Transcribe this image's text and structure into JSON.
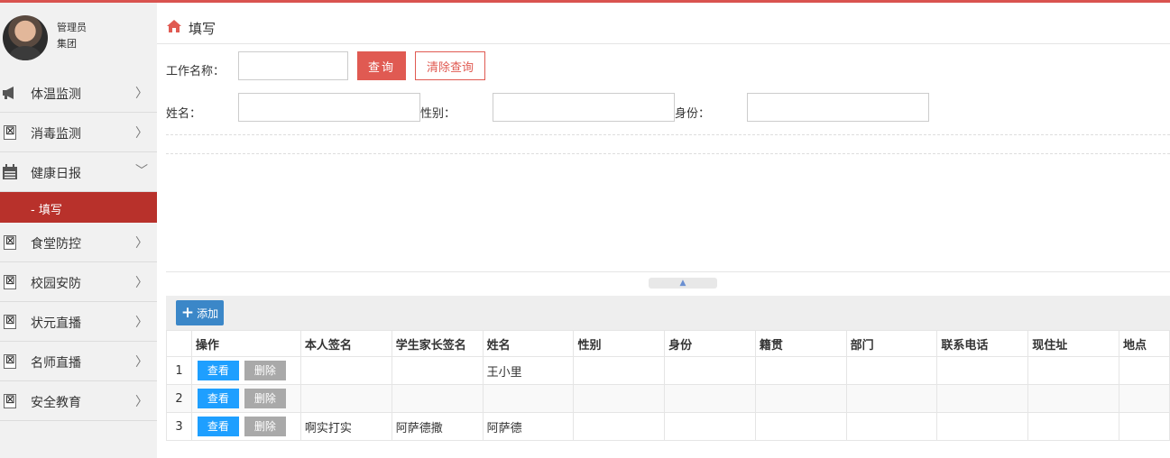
{
  "user": {
    "role": "管理员",
    "org": "集团"
  },
  "sidebar": {
    "items": [
      {
        "label": "体温监测",
        "icon": "megaphone-icon",
        "chevron": ">"
      },
      {
        "label": "消毒监测",
        "icon": "broken-image-icon",
        "chevron": ">"
      },
      {
        "label": "健康日报",
        "icon": "calendar-icon",
        "chevron": "v",
        "expanded": true
      },
      {
        "label": "食堂防控",
        "icon": "broken-image-icon",
        "chevron": ">"
      },
      {
        "label": "校园安防",
        "icon": "broken-image-icon",
        "chevron": ">"
      },
      {
        "label": "状元直播",
        "icon": "broken-image-icon",
        "chevron": ">"
      },
      {
        "label": "名师直播",
        "icon": "broken-image-icon",
        "chevron": ">"
      },
      {
        "label": "安全教育",
        "icon": "broken-image-icon",
        "chevron": ">"
      }
    ],
    "active_sub": "- 填写"
  },
  "breadcrumb": {
    "title": "填写"
  },
  "search": {
    "job_name_label": "工作名称：",
    "job_name_value": "",
    "query_label": "查询",
    "clear_label": "清除查询",
    "name_label": "姓名：",
    "gender_label": "性别：",
    "identity_label": "身份："
  },
  "toolbar": {
    "add_label": "添加"
  },
  "table": {
    "headers": [
      "操作",
      "本人签名",
      "学生家长签名",
      "姓名",
      "性别",
      "身份",
      "籍贯",
      "部门",
      "联系电话",
      "现住址",
      "地点"
    ],
    "view_label": "查看",
    "delete_label": "删除",
    "rows": [
      {
        "index": "1",
        "self_sign": "",
        "parent_sign": "",
        "name": "王小里",
        "gender": "",
        "identity": "",
        "origin": "",
        "dept": "",
        "phone": "",
        "address": "",
        "place": ""
      },
      {
        "index": "2",
        "self_sign": "",
        "parent_sign": "",
        "name": "",
        "gender": "",
        "identity": "",
        "origin": "",
        "dept": "",
        "phone": "",
        "address": "",
        "place": ""
      },
      {
        "index": "3",
        "self_sign": "啊实打实",
        "parent_sign": "阿萨德撒",
        "name": "阿萨德",
        "gender": "",
        "identity": "",
        "origin": "",
        "dept": "",
        "phone": "",
        "address": "",
        "place": ""
      }
    ]
  },
  "colors": {
    "accent": "#e05a52",
    "active_sub_bg": "#b8312b",
    "add_button": "#3b87c8",
    "view_button": "#1e9fff"
  }
}
